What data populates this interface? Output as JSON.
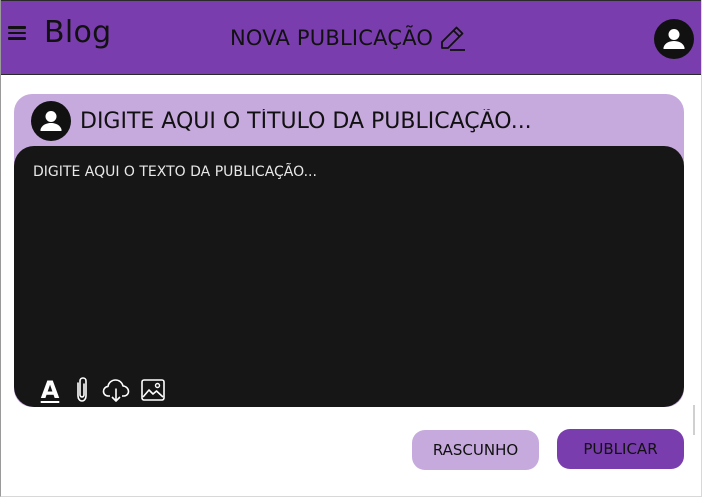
{
  "header": {
    "brand": "Blog",
    "page_title": "NOVA PUBLICAÇÃO"
  },
  "icons": {
    "menu": "menu-icon",
    "edit": "pencil-icon",
    "profile": "account-circle-icon",
    "text_format": "text-format-icon",
    "attachment": "paperclip-icon",
    "upload": "cloud-download-icon",
    "image": "image-icon"
  },
  "post": {
    "title_placeholder": "DIGITE AQUI O TÍTULO DA PUBLICAÇÃO...",
    "title_value": "",
    "body_placeholder": "DIGITE AQUI O TEXTO DA PUBLICAÇÃO...",
    "body_value": "",
    "text_format_glyph": "A"
  },
  "actions": {
    "draft_label": "RASCUNHO",
    "publish_label": "PUBLICAR"
  },
  "colors": {
    "header_bg": "#7a3dae",
    "card_bg": "#c6a9dd",
    "editor_bg": "#161616",
    "primary_button": "#7a3dae",
    "secondary_button": "#c6a9dd"
  }
}
